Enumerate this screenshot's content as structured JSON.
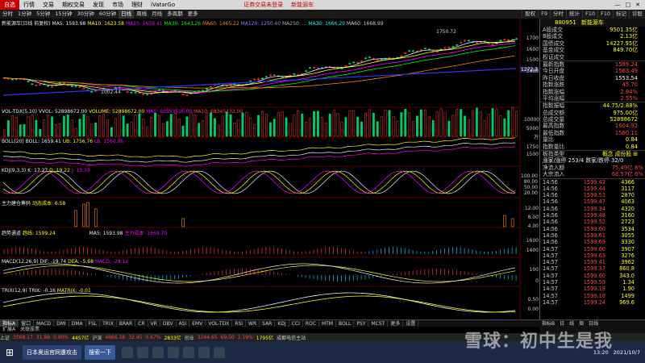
{
  "menu": [
    "自选",
    "行情",
    "交易",
    "期权交易",
    "发现",
    "市场",
    "理财",
    "iVatarGo"
  ],
  "center_links": [
    "证券交易未登录",
    "新能源车"
  ],
  "window_buttons": [
    "—",
    "□",
    "✕"
  ],
  "toolbar": [
    "分时",
    "1分钟",
    "5分钟",
    "15分钟",
    "30分钟",
    "60分钟",
    "日线",
    "周线",
    "月线",
    "多周期",
    "更多"
  ],
  "toolbar_right": [
    "股权",
    "F9",
    "分时",
    "统计",
    "F10",
    "F10",
    "标记",
    "诊股"
  ],
  "main": {
    "title": "新能源车(日线 前复权)",
    "ma": [
      {
        "t": "MA5: 1593.98",
        "c": "#eee"
      },
      {
        "t": "MA10: 1623.58",
        "c": "#ff0"
      },
      {
        "t": "MA20: 1659.41",
        "c": "#f0f"
      },
      {
        "t": "MA30: 1643.26",
        "c": "#0f0"
      },
      {
        "t": "MA60: 1465.22",
        "c": "#f80"
      },
      {
        "t": "MA120: 1250.40",
        "c": "#88f"
      },
      {
        "t": "MA250: ...",
        "c": "#aaa"
      },
      {
        "t": "MA30: 1666.29",
        "c": "#0ff"
      },
      {
        "t": "MA60: 1668.99",
        "c": "#ccc"
      }
    ],
    "axis": [
      "1700",
      "1600",
      "1500",
      "1400",
      "1300",
      "1200",
      "1100",
      "1000"
    ],
    "high_label": "1750.72",
    "low_label": "1002.44",
    "price_tag": "1272.3"
  },
  "vol": {
    "title": "VOL-TDX(5,10)",
    "vvol": "VVOL: 52898672.00",
    "volume": "VOLUME: 52898672.00",
    "ma5": "MA5: 60553516.00",
    "ma10": "MA10: 68345432.00",
    "axis": [
      "10000",
      "5000",
      "万"
    ]
  },
  "boll": {
    "title": "BOLL(20)",
    "boll": "BOLL: 1659.41",
    "ub": "UB: 1756.76",
    "lb": "LB: 1560.06",
    "axis": [
      "1750",
      "1500"
    ]
  },
  "kdj": {
    "title": "KDJ(9,3,3)",
    "k": "K: 17.27",
    "d": "D: 19.22",
    "j": "J: 13.39",
    "axis": [
      "100.00",
      "80.00",
      "50.00",
      "20.00"
    ]
  },
  "zl": {
    "title": "主力建仓筹码",
    "d": "动态成本: 6.58",
    "axis": [
      "12.00",
      "8.00",
      "4.00"
    ]
  },
  "trend": {
    "title": "趋势通道",
    "line": "趋线: 1599.24",
    "ma": "MA5: 1593.98",
    "zl": "主力成本: 1669.70",
    "axis": [
      "1600",
      "1400"
    ]
  },
  "macd": {
    "title": "MACD(12,26,9)",
    "dif": "DIF: -19.74",
    "dea": "DEA: -5.68",
    "macd": "MACD: -28.12",
    "axis": [
      "100",
      "0"
    ]
  },
  "trix": {
    "title": "TRIX(12,9)",
    "trix": "TRIX: -0.16",
    "matrix": "MATRIX: -0.01",
    "axis": [
      "0.50",
      "0.00"
    ]
  },
  "right": {
    "code": "880951",
    "name": "新能源车",
    "rows": [
      {
        "k": "A股成交",
        "v": "9501.35亿",
        "c": "c-yellow"
      },
      {
        "k": "B股成交",
        "v": "2.13亿",
        "c": "c-yellow"
      },
      {
        "k": "国债成交",
        "v": "14227.95亿",
        "c": "c-yellow"
      },
      {
        "k": "基金成交",
        "v": "849.70亿",
        "c": "c-yellow"
      },
      {
        "k": "权证成交",
        "v": "",
        "c": "c-yellow"
      },
      {
        "k": "最新指数",
        "v": "1599.24",
        "c": "c-red"
      },
      {
        "k": "今日开盘",
        "v": "1563.49",
        "c": "c-red"
      },
      {
        "k": "昨日收盘",
        "v": "1553.54",
        "c": "c-white"
      },
      {
        "k": "指数涨跌",
        "v": "45.70",
        "c": "c-red"
      },
      {
        "k": "指数涨幅",
        "v": "2.94%",
        "c": "c-red"
      },
      {
        "k": "平均涨幅",
        "v": "2.55%",
        "c": "c-red"
      },
      {
        "k": "指数振幅",
        "v": "44.75/2.88%",
        "c": "c-yellow"
      },
      {
        "k": "总成交额",
        "v": "975.00亿",
        "c": "c-yellow"
      },
      {
        "k": "总成交量",
        "v": "52898672",
        "c": "c-yellow"
      },
      {
        "k": "最高指数",
        "v": "1604.92",
        "c": "c-red"
      },
      {
        "k": "最低指数",
        "v": "1560.11",
        "c": "c-red"
      },
      {
        "k": "量比",
        "v": "0.84",
        "c": "c-yellow"
      },
      {
        "k": "指数量比",
        "v": "0.84",
        "c": "c-yellow"
      }
    ],
    "board_label": "板指类型",
    "board_value": "概念 成份股 ⊞",
    "updown": "涨家/涨停  253/4  跌家/跌停  32/0",
    "net_in": {
      "k": "净流入额",
      "v": "75.49亿",
      "p": "8%"
    },
    "big_in": {
      "k": "大宗流入",
      "v": "68.57亿",
      "p": "6%"
    },
    "trades": [
      {
        "t": "14:56",
        "p": "1599.42",
        "v": "4366"
      },
      {
        "t": "14:56",
        "p": "1599.44",
        "v": "3117"
      },
      {
        "t": "14:56",
        "p": "1599.53",
        "v": "2870"
      },
      {
        "t": "14:56",
        "p": "1599.47",
        "v": "4063"
      },
      {
        "t": "14:56",
        "p": "1599.34",
        "v": "4320"
      },
      {
        "t": "14:56",
        "p": "1599.48",
        "v": "3160"
      },
      {
        "t": "14:56",
        "p": "1599.52",
        "v": "2723"
      },
      {
        "t": "14:56",
        "p": "1599.60",
        "v": "3534"
      },
      {
        "t": "14:56",
        "p": "1599.61",
        "v": "3055"
      },
      {
        "t": "14:56",
        "p": "1599.69",
        "v": "3330"
      },
      {
        "t": "14:57",
        "p": "1599.60",
        "v": "3907"
      },
      {
        "t": "14:57",
        "p": "1599.63",
        "v": "3276"
      },
      {
        "t": "14:57",
        "p": "1599.41",
        "v": "3962"
      },
      {
        "t": "14:57",
        "p": "1599.37",
        "v": "860.8"
      },
      {
        "t": "14:57",
        "p": "1599.60",
        "v": "343.0"
      },
      {
        "t": "14:57",
        "p": "1599.59",
        "v": "1.34"
      },
      {
        "t": "14:57",
        "p": "1599.18",
        "v": "1.90"
      },
      {
        "t": "14:57",
        "p": "1599.18",
        "v": "1499"
      },
      {
        "t": "14:57",
        "p": "1599.24",
        "v": "969.6"
      }
    ]
  },
  "tabs": [
    "指标A",
    "窗口",
    "MACD",
    "DMI",
    "DMA",
    "FSL",
    "TRIX",
    "BRAR",
    "CR",
    "VR",
    "OBV",
    "ASI",
    "EMV",
    "VOL-TDX",
    "RSI",
    "WR",
    "SAR",
    "KDJ",
    "CCI",
    "ROC",
    "MTM",
    "BOLL",
    "PSY",
    "MCST",
    "更多",
    "设置"
  ],
  "tabs_right": [
    "指标B",
    "日",
    "线",
    "周",
    "日线"
  ],
  "subtabs": [
    "扩展A",
    "关联股票"
  ],
  "status": [
    {
      "t": "上证",
      "c": "#ccc"
    },
    {
      "t": "3568.17",
      "c": "#f44"
    },
    {
      "t": "31.88",
      "c": "#f44"
    },
    {
      "t": "0.90%",
      "c": "#f44"
    },
    {
      "t": "4457亿",
      "c": "#ff0"
    },
    {
      "t": "沪深",
      "c": "#ccc"
    },
    {
      "t": "4866.38",
      "c": "#f44"
    },
    {
      "t": "32.45",
      "c": "#f44"
    },
    {
      "t": "0.67%",
      "c": "#f44"
    },
    {
      "t": "2833亿",
      "c": "#ff0"
    },
    {
      "t": "创业",
      "c": "#ccc"
    },
    {
      "t": "3244.65",
      "c": "#f44"
    },
    {
      "t": "69.50",
      "c": "#f44"
    },
    {
      "t": "2.19%",
      "c": "#f44"
    },
    {
      "t": "1795亿",
      "c": "#ff0"
    },
    {
      "t": "成都电信主站",
      "c": "#ccc"
    }
  ],
  "taskbar": {
    "app1": "日本奥运官网遭攻击",
    "app2": "搜索一下",
    "time": "13:20",
    "date": "2021/10/7"
  },
  "watermark": "雪球：初中生是我",
  "colors": {
    "up": "#ff3333",
    "down": "#00cc66",
    "accent": "#cc0000"
  }
}
